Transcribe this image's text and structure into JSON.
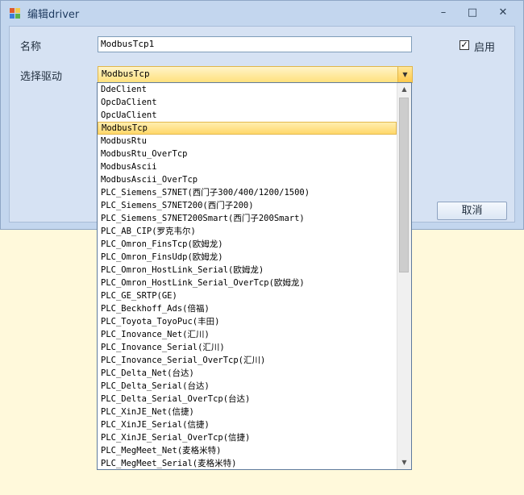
{
  "window": {
    "title": "编辑driver",
    "minimize": "–",
    "maximize": "□",
    "close": "✕"
  },
  "form": {
    "name_label": "名称",
    "name_value": "ModbusTcp1",
    "driver_label": "选择驱动",
    "driver_value": "ModbusTcp",
    "enabled_label": "启用",
    "enabled_checked": true,
    "cancel_label": "取消"
  },
  "dropdown": {
    "selected_index": 3,
    "items": [
      "DdeClient",
      "OpcDaClient",
      "OpcUaClient",
      "ModbusTcp",
      "ModbusRtu",
      "ModbusRtu_OverTcp",
      "ModbusAscii",
      "ModbusAscii_OverTcp",
      "PLC_Siemens_S7NET(西门子300/400/1200/1500)",
      "PLC_Siemens_S7NET200(西门子200)",
      "PLC_Siemens_S7NET200Smart(西门子200Smart)",
      "PLC_AB_CIP(罗克韦尔)",
      "PLC_Omron_FinsTcp(欧姆龙)",
      "PLC_Omron_FinsUdp(欧姆龙)",
      "PLC_Omron_HostLink_Serial(欧姆龙)",
      "PLC_Omron_HostLink_Serial_OverTcp(欧姆龙)",
      "PLC_GE_SRTP(GE)",
      "PLC_Beckhoff_Ads(倍福)",
      "PLC_Toyota_ToyoPuc(丰田)",
      "PLC_Inovance_Net(汇川)",
      "PLC_Inovance_Serial(汇川)",
      "PLC_Inovance_Serial_OverTcp(汇川)",
      "PLC_Delta_Net(台达)",
      "PLC_Delta_Serial(台达)",
      "PLC_Delta_Serial_OverTcp(台达)",
      "PLC_XinJE_Net(信捷)",
      "PLC_XinJE_Serial(信捷)",
      "PLC_XinJE_Serial_OverTcp(信捷)",
      "PLC_MegMeet_Net(麦格米特)",
      "PLC_MegMeet_Serial(麦格米特)"
    ]
  },
  "icons": {
    "app": "app-icon",
    "dropdown_arrow": "▼",
    "scroll_up": "▲",
    "scroll_down": "▼",
    "checkmark": "✓"
  },
  "colors": {
    "window_bg": "#c3d6ee",
    "selection": "#ffd76a",
    "desktop": "#fff9db"
  }
}
